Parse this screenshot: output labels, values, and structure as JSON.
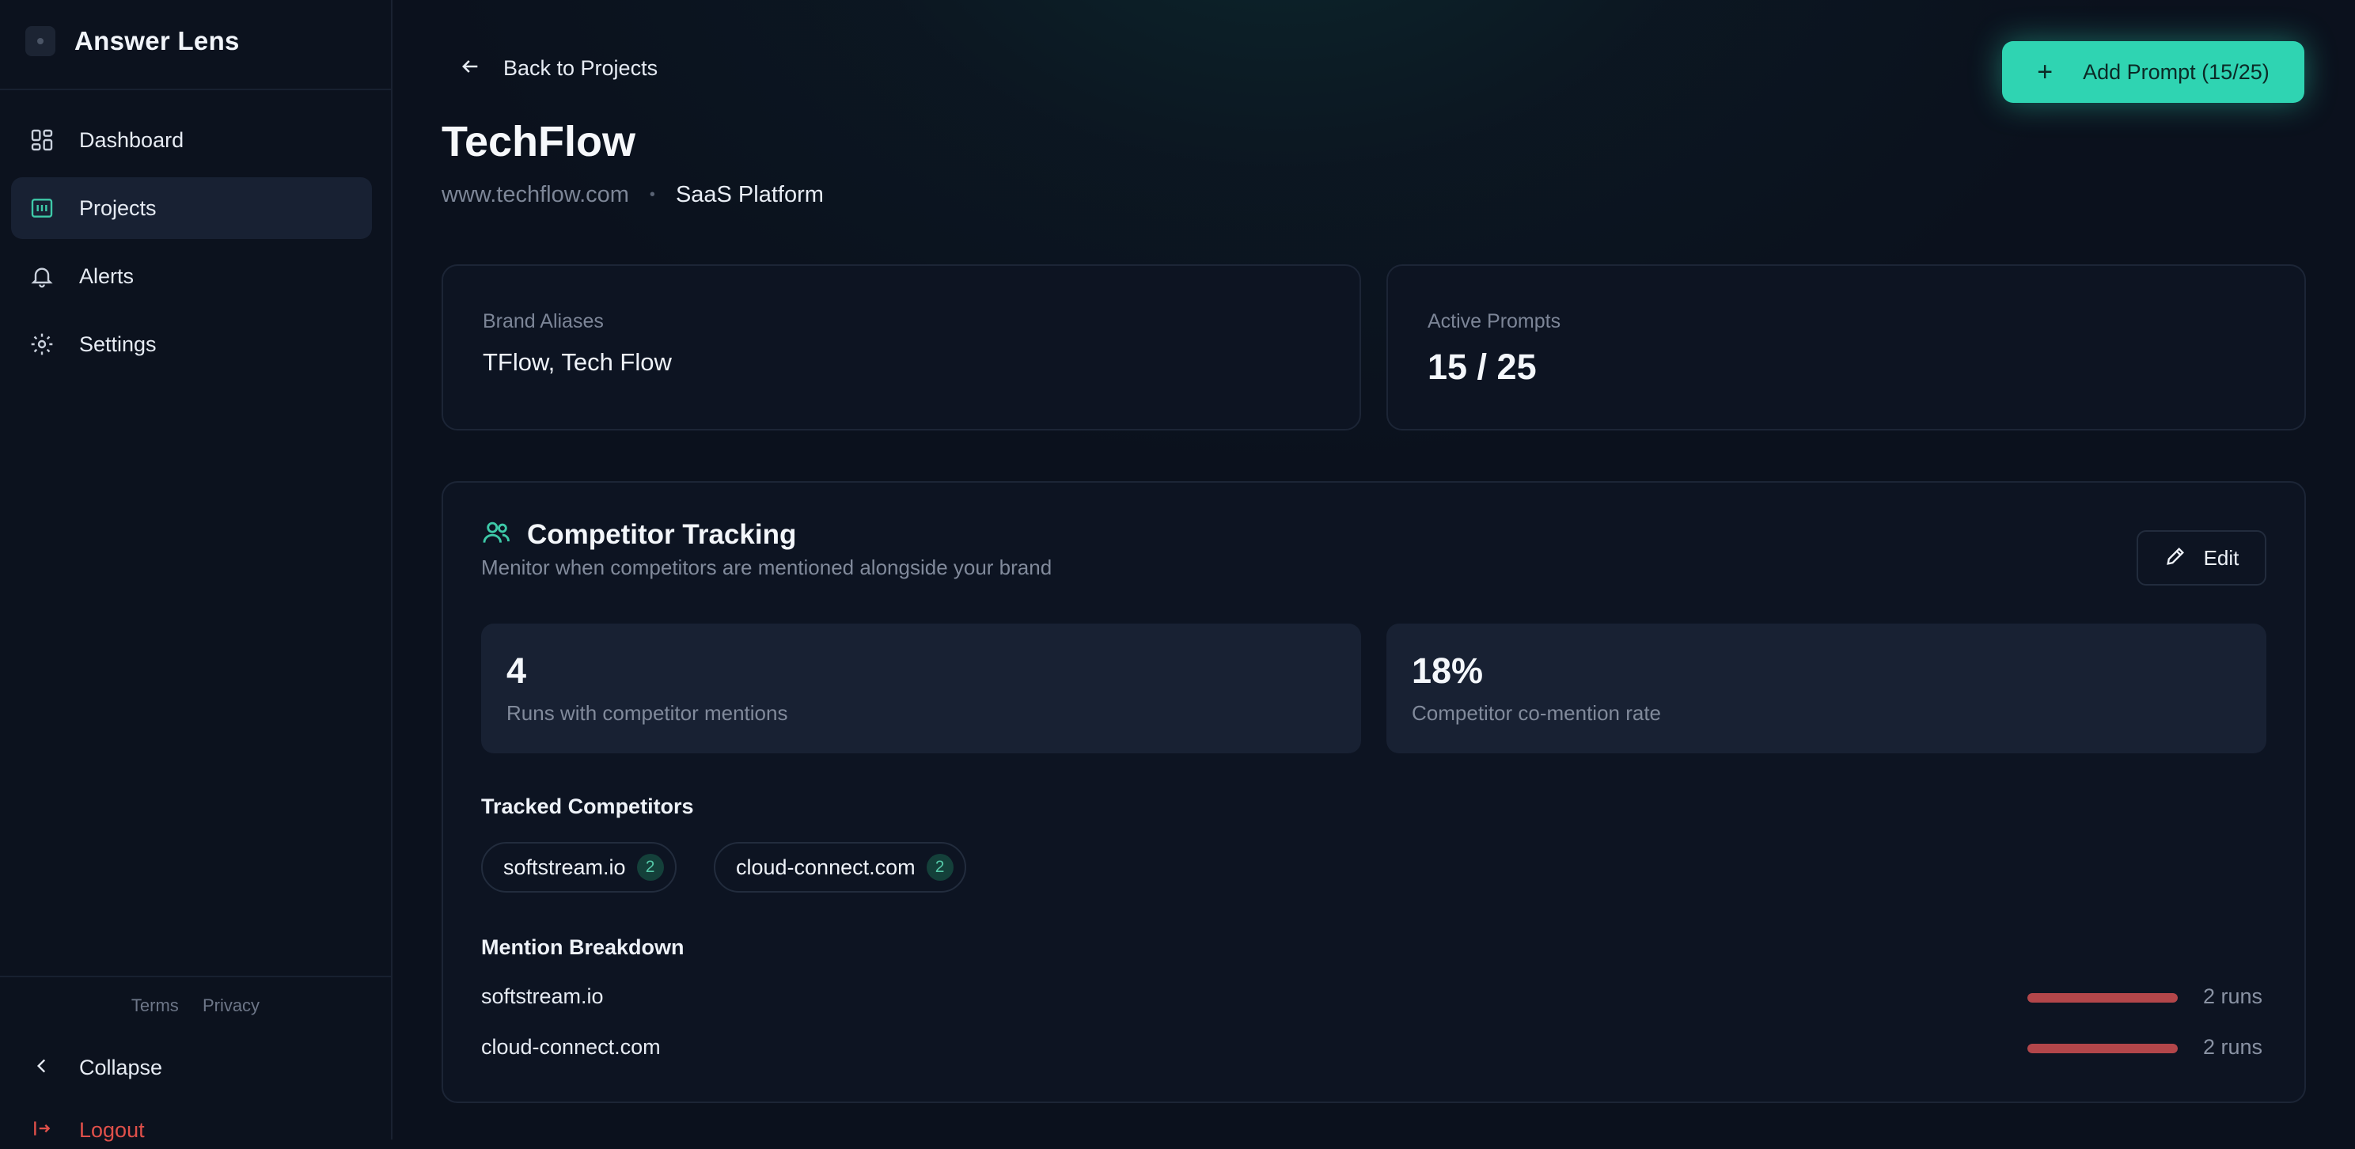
{
  "app": {
    "name": "Answer Lens"
  },
  "sidebar": {
    "items": [
      {
        "label": "Dashboard",
        "icon": "dashboard-icon",
        "active": false
      },
      {
        "label": "Projects",
        "icon": "projects-icon",
        "active": true
      },
      {
        "label": "Alerts",
        "icon": "bell-icon",
        "active": false
      },
      {
        "label": "Settings",
        "icon": "gear-icon",
        "active": false
      }
    ],
    "footer_links": {
      "terms": "Terms",
      "privacy": "Privacy"
    },
    "collapse_label": "Collapse",
    "logout_label": "Logout"
  },
  "header": {
    "back_label": "Back to Projects",
    "add_prompt_label": "Add Prompt (15/25)"
  },
  "project": {
    "name": "TechFlow",
    "url": "www.techflow.com",
    "category": "SaaS Platform"
  },
  "cards": {
    "aliases": {
      "label": "Brand Aliases",
      "value": "TFlow, Tech Flow"
    },
    "prompts": {
      "label": "Active Prompts",
      "value": "15 / 25"
    }
  },
  "competitor_tracking": {
    "title": "Competitor Tracking",
    "description": "Menitor when competitors are mentioned alongside your brand",
    "edit_label": "Edit",
    "stats": [
      {
        "value": "4",
        "label": "Runs with competitor mentions"
      },
      {
        "value": "18%",
        "label": "Competitor co-mention rate"
      }
    ],
    "tracked_title": "Tracked Competitors",
    "tracked": [
      {
        "name": "softstream.io",
        "count": "2"
      },
      {
        "name": "cloud-connect.com",
        "count": "2"
      }
    ],
    "breakdown_title": "Mention Breakdown",
    "breakdown": [
      {
        "name": "softstream.io",
        "runs": "2 runs",
        "fraction": 1.0
      },
      {
        "name": "cloud-connect.com",
        "runs": "2 runs",
        "fraction": 1.0
      }
    ]
  },
  "colors": {
    "accent": "#2fd4b2",
    "background": "#0b111d",
    "danger": "#e0504a",
    "bar": "#b3464a"
  }
}
